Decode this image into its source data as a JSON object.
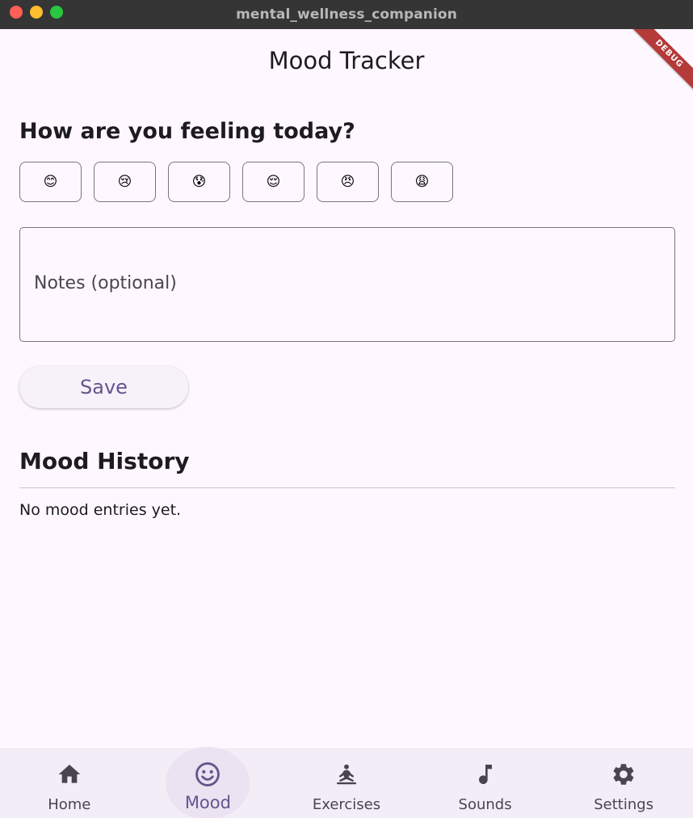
{
  "window": {
    "title": "mental_wellness_companion"
  },
  "appbar": {
    "title": "Mood Tracker",
    "debug_banner": "DEBUG"
  },
  "mood_prompt": "How are you feeling today?",
  "moods": [
    "😊",
    "😢",
    "😰",
    "😌",
    "😠",
    "😩"
  ],
  "notes": {
    "label": "Notes (optional)"
  },
  "save_label": "Save",
  "history": {
    "title": "Mood History",
    "empty": "No mood entries yet."
  },
  "nav": {
    "items": [
      {
        "label": "Home",
        "icon": "home-icon"
      },
      {
        "label": "Mood",
        "icon": "mood-icon",
        "active": true
      },
      {
        "label": "Exercises",
        "icon": "meditation-icon"
      },
      {
        "label": "Sounds",
        "icon": "music-note-icon"
      },
      {
        "label": "Settings",
        "icon": "gear-icon"
      }
    ]
  },
  "colors": {
    "background": "#fef7ff",
    "primary": "#65558f",
    "nav_background": "#f3edf7",
    "debug_ribbon": "#b53a3a"
  }
}
